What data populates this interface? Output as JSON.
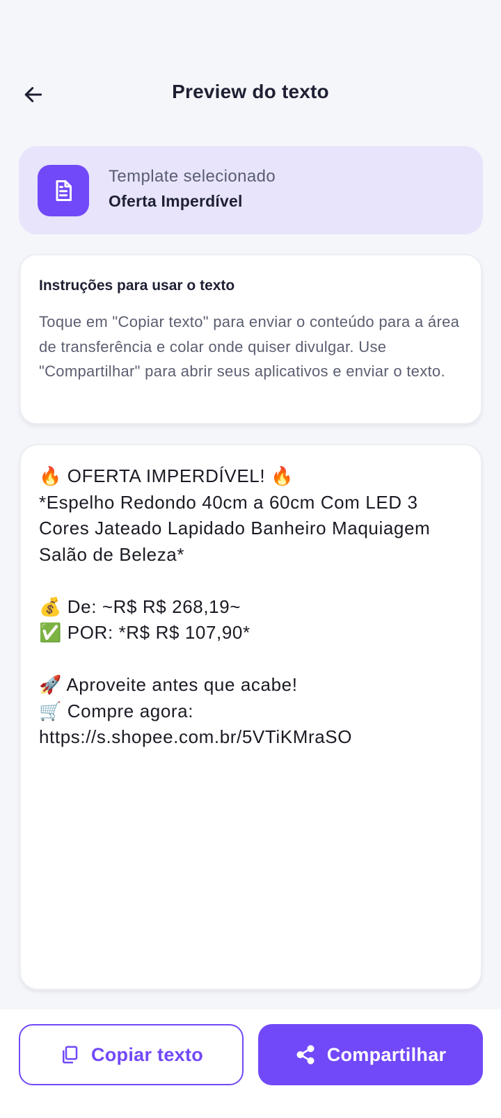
{
  "header": {
    "title": "Preview do texto",
    "back_icon": "arrow-left-icon"
  },
  "template": {
    "caption": "Template selecionado",
    "name": "Oferta Imperdível",
    "icon": "document-icon"
  },
  "instructions": {
    "title": "Instruções para usar o texto",
    "body": "Toque em \"Copiar texto\" para enviar o conteúdo para a área de transferência e colar onde quiser divulgar. Use \"Compartilhar\" para abrir seus aplicativos e enviar o texto."
  },
  "preview": {
    "text": "🔥 OFERTA IMPERDÍVEL! 🔥\n*Espelho Redondo 40cm a 60cm Com LED 3 Cores Jateado Lapidado Banheiro Maquiagem Salão de Beleza*\n\n💰 De: ~R$ R$ 268,19~\n✅ POR: *R$ R$ 107,90*\n\n🚀 Aproveite antes que acabe!\n🛒 Compre agora: https://s.shopee.com.br/5VTiKMraSO"
  },
  "actions": {
    "copy_label": "Copiar texto",
    "copy_icon": "copy-icon",
    "share_label": "Compartilhar",
    "share_icon": "share-icon"
  },
  "colors": {
    "accent": "#7149f8",
    "template_card_bg": "#e7e4fb",
    "background": "#f5f6fa"
  }
}
